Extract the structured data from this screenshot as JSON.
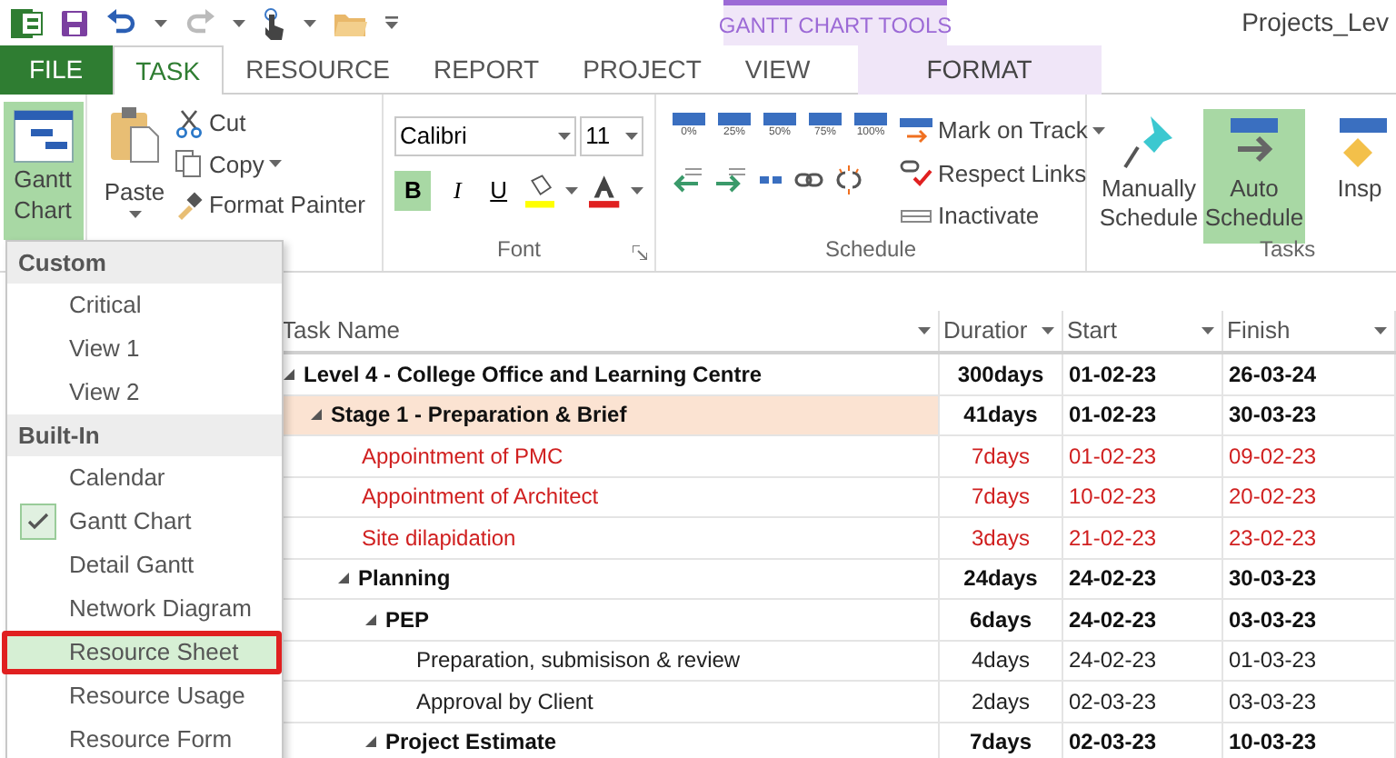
{
  "title_bar": {
    "context_tools": "GANTT CHART TOOLS",
    "title": "Projects_Lev"
  },
  "tabs": [
    {
      "label": "FILE",
      "kind": "file",
      "selected": false
    },
    {
      "label": "TASK",
      "kind": "tab",
      "selected": true
    },
    {
      "label": "RESOURCE",
      "kind": "tab",
      "selected": false
    },
    {
      "label": "REPORT",
      "kind": "tab",
      "selected": false
    },
    {
      "label": "PROJECT",
      "kind": "tab",
      "selected": false
    },
    {
      "label": "VIEW",
      "kind": "tab",
      "selected": false
    },
    {
      "label": "FORMAT",
      "kind": "context",
      "selected": false
    }
  ],
  "ribbon": {
    "view": {
      "label": "Gantt Chart",
      "selected": true
    },
    "clipboard": {
      "paste": "Paste",
      "cut": "Cut",
      "copy": "Copy",
      "format_painter": "Format Painter"
    },
    "font": {
      "font_name": "Calibri",
      "font_size": "11",
      "bold": "B",
      "bold_on": true,
      "italic": "I",
      "underline": "U",
      "label": "Font"
    },
    "schedule": {
      "percents": [
        "0%",
        "25%",
        "50%",
        "75%",
        "100%"
      ],
      "mark_on_track": "Mark on Track",
      "respect_links": "Respect Links",
      "inactivate": "Inactivate",
      "label": "Schedule"
    },
    "tasks": {
      "buttons": [
        {
          "label": "Manually Schedule",
          "kind": "pin",
          "selected": false
        },
        {
          "label": "Auto Schedule",
          "kind": "auto",
          "selected": true
        },
        {
          "label": "Insp",
          "kind": "inspect",
          "selected": false
        }
      ],
      "label": "Tasks"
    }
  },
  "view_menu": {
    "sections": [
      {
        "header": "Custom",
        "items": [
          {
            "label": "Critical",
            "checked": false,
            "selected": false
          },
          {
            "label": "View 1",
            "checked": false,
            "selected": false
          },
          {
            "label": "View 2",
            "checked": false,
            "selected": false
          }
        ]
      },
      {
        "header": "Built-In",
        "items": [
          {
            "label": "Calendar",
            "checked": false,
            "selected": false
          },
          {
            "label": "Gantt Chart",
            "checked": true,
            "selected": false
          },
          {
            "label": "Detail Gantt",
            "checked": false,
            "selected": false
          },
          {
            "label": "Network Diagram",
            "checked": false,
            "selected": false
          },
          {
            "label": "Resource Sheet",
            "checked": false,
            "selected": true
          },
          {
            "label": "Resource Usage",
            "checked": false,
            "selected": false
          },
          {
            "label": "Resource Form",
            "checked": false,
            "selected": false
          }
        ]
      }
    ]
  },
  "table": {
    "columns": [
      "Task Name",
      "Duratior",
      "Start",
      "Finish"
    ],
    "rows": [
      {
        "name": "Level 4 - College Office and Learning Centre",
        "duration": "300days",
        "start": "01-02-23",
        "finish": "26-03-24",
        "kind": "summary",
        "critical": false,
        "selected": false,
        "expanded": true,
        "children": [
          {
            "name": "Stage 1 - Preparation & Brief",
            "duration": "41days",
            "start": "01-02-23",
            "finish": "30-03-23",
            "kind": "summary",
            "critical": false,
            "selected": true,
            "expanded": true,
            "children": [
              {
                "name": "Appointment of PMC",
                "duration": "7days",
                "start": "01-02-23",
                "finish": "09-02-23",
                "kind": "task",
                "critical": true,
                "selected": false
              },
              {
                "name": "Appointment of Architect",
                "duration": "7days",
                "start": "10-02-23",
                "finish": "20-02-23",
                "kind": "task",
                "critical": true,
                "selected": false
              },
              {
                "name": "Site dilapidation",
                "duration": "3days",
                "start": "21-02-23",
                "finish": "23-02-23",
                "kind": "task",
                "critical": true,
                "selected": false
              },
              {
                "name": "Planning",
                "duration": "24days",
                "start": "24-02-23",
                "finish": "30-03-23",
                "kind": "summary",
                "critical": false,
                "selected": false,
                "expanded": true,
                "children": [
                  {
                    "name": "PEP",
                    "duration": "6days",
                    "start": "24-02-23",
                    "finish": "03-03-23",
                    "kind": "summary",
                    "critical": false,
                    "selected": false,
                    "expanded": true,
                    "children": [
                      {
                        "name": "Preparation, submisison & review",
                        "duration": "4days",
                        "start": "24-02-23",
                        "finish": "01-03-23",
                        "kind": "task",
                        "critical": false,
                        "selected": false
                      },
                      {
                        "name": "Approval by Client",
                        "duration": "2days",
                        "start": "02-03-23",
                        "finish": "03-03-23",
                        "kind": "task",
                        "critical": false,
                        "selected": false
                      }
                    ]
                  },
                  {
                    "name": "Project Estimate",
                    "duration": "7days",
                    "start": "02-03-23",
                    "finish": "10-03-23",
                    "kind": "summary",
                    "critical": false,
                    "selected": false,
                    "expanded": true
                  }
                ]
              }
            ]
          }
        ]
      }
    ]
  }
}
